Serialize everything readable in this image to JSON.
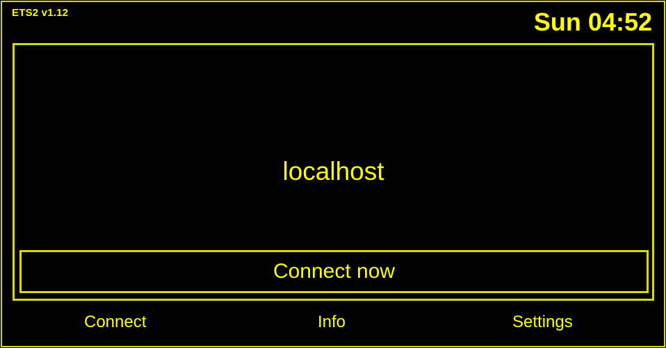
{
  "header": {
    "app_title": "ETS2 v1.12",
    "clock": "Sun 04:52"
  },
  "main": {
    "host": "localhost",
    "connect_button_label": "Connect now"
  },
  "nav": {
    "items": [
      {
        "label": "Connect"
      },
      {
        "label": "Info"
      },
      {
        "label": "Settings"
      }
    ]
  },
  "colors": {
    "background": "#000000",
    "accent": "#ffff00",
    "border": "#d9d900"
  }
}
